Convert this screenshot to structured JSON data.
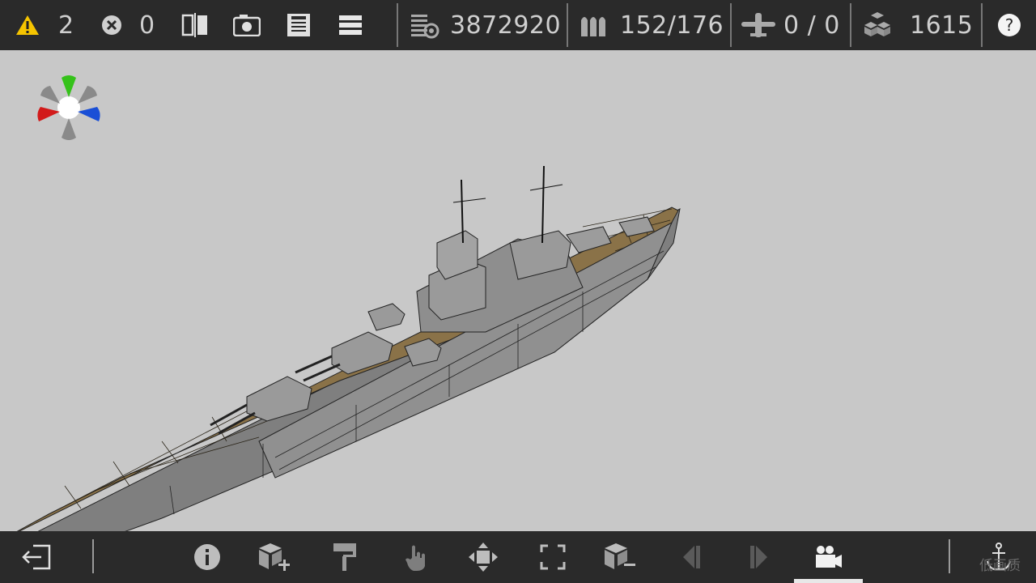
{
  "topbar": {
    "warnings": "2",
    "errors": "0",
    "cost": "3872920",
    "ammo": "152/176",
    "aircraft": "0 / 0",
    "blocks": "1615"
  },
  "quality_label": "低画质",
  "colors": {
    "warning": "#f5c400",
    "deck": "#8a7248",
    "hull": "#8c8c8c",
    "gizmo_x": "#d21a1a",
    "gizmo_y": "#35c21a",
    "gizmo_z": "#1a4fd6"
  },
  "icons": {
    "top": [
      "warning-icon",
      "error-icon",
      "mirror-icon",
      "camera-icon",
      "save-icon",
      "menu-icon",
      "cost-icon",
      "ammo-icon",
      "aircraft-icon",
      "blocks-icon",
      "help-icon"
    ],
    "bottom": [
      "exit-icon",
      "info-icon",
      "add-block-icon",
      "paint-roller-icon",
      "select-hand-icon",
      "move-icon",
      "rotate-frame-icon",
      "remove-block-icon",
      "prev-icon",
      "next-icon",
      "camera-mode-icon",
      "anchor-icon"
    ]
  }
}
